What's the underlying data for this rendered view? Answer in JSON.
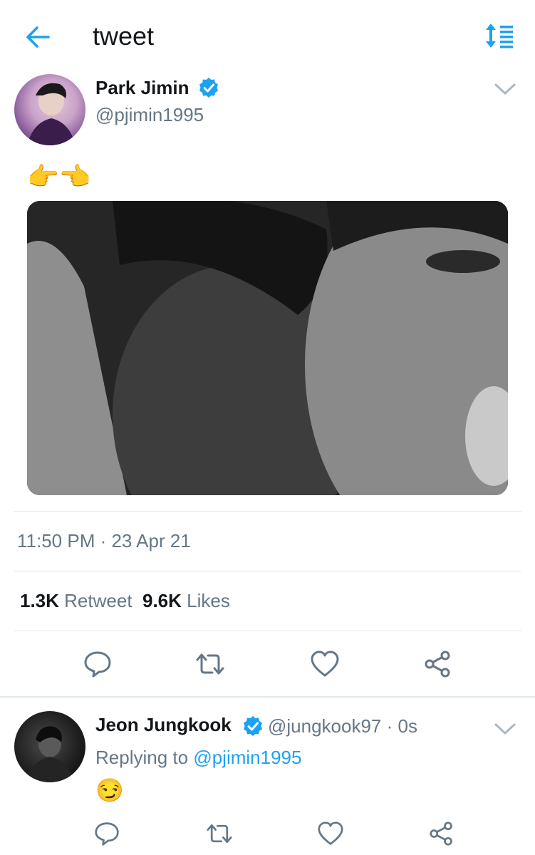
{
  "header": {
    "title": "tweet"
  },
  "tweet": {
    "author_name": "Park Jimin",
    "author_handle": "@pjimin1995",
    "text": "👉👈",
    "timestamp": "11:50 PM · 23 Apr 21",
    "retweet_count": "1.3K",
    "retweet_label": "Retweet",
    "likes_count": "9.6K",
    "likes_label": "Likes"
  },
  "reply": {
    "author_name": "Jeon Jungkook",
    "meta": "@jungkook97 · 0s",
    "replying_prefix": "Replying to",
    "replying_handle": "@pjimin1995",
    "text": "😏"
  },
  "icons": {
    "back": "arrow-left-icon",
    "sort": "sort-list-icon",
    "verified": "verified-badge-icon",
    "chevron": "chevron-down-icon",
    "reply": "reply-bubble-icon",
    "retweet": "retweet-icon",
    "like": "heart-icon",
    "share": "share-icon"
  },
  "colors": {
    "accent": "#1da1f2",
    "secondary_text": "#657786",
    "divider": "#e1e8ed"
  }
}
